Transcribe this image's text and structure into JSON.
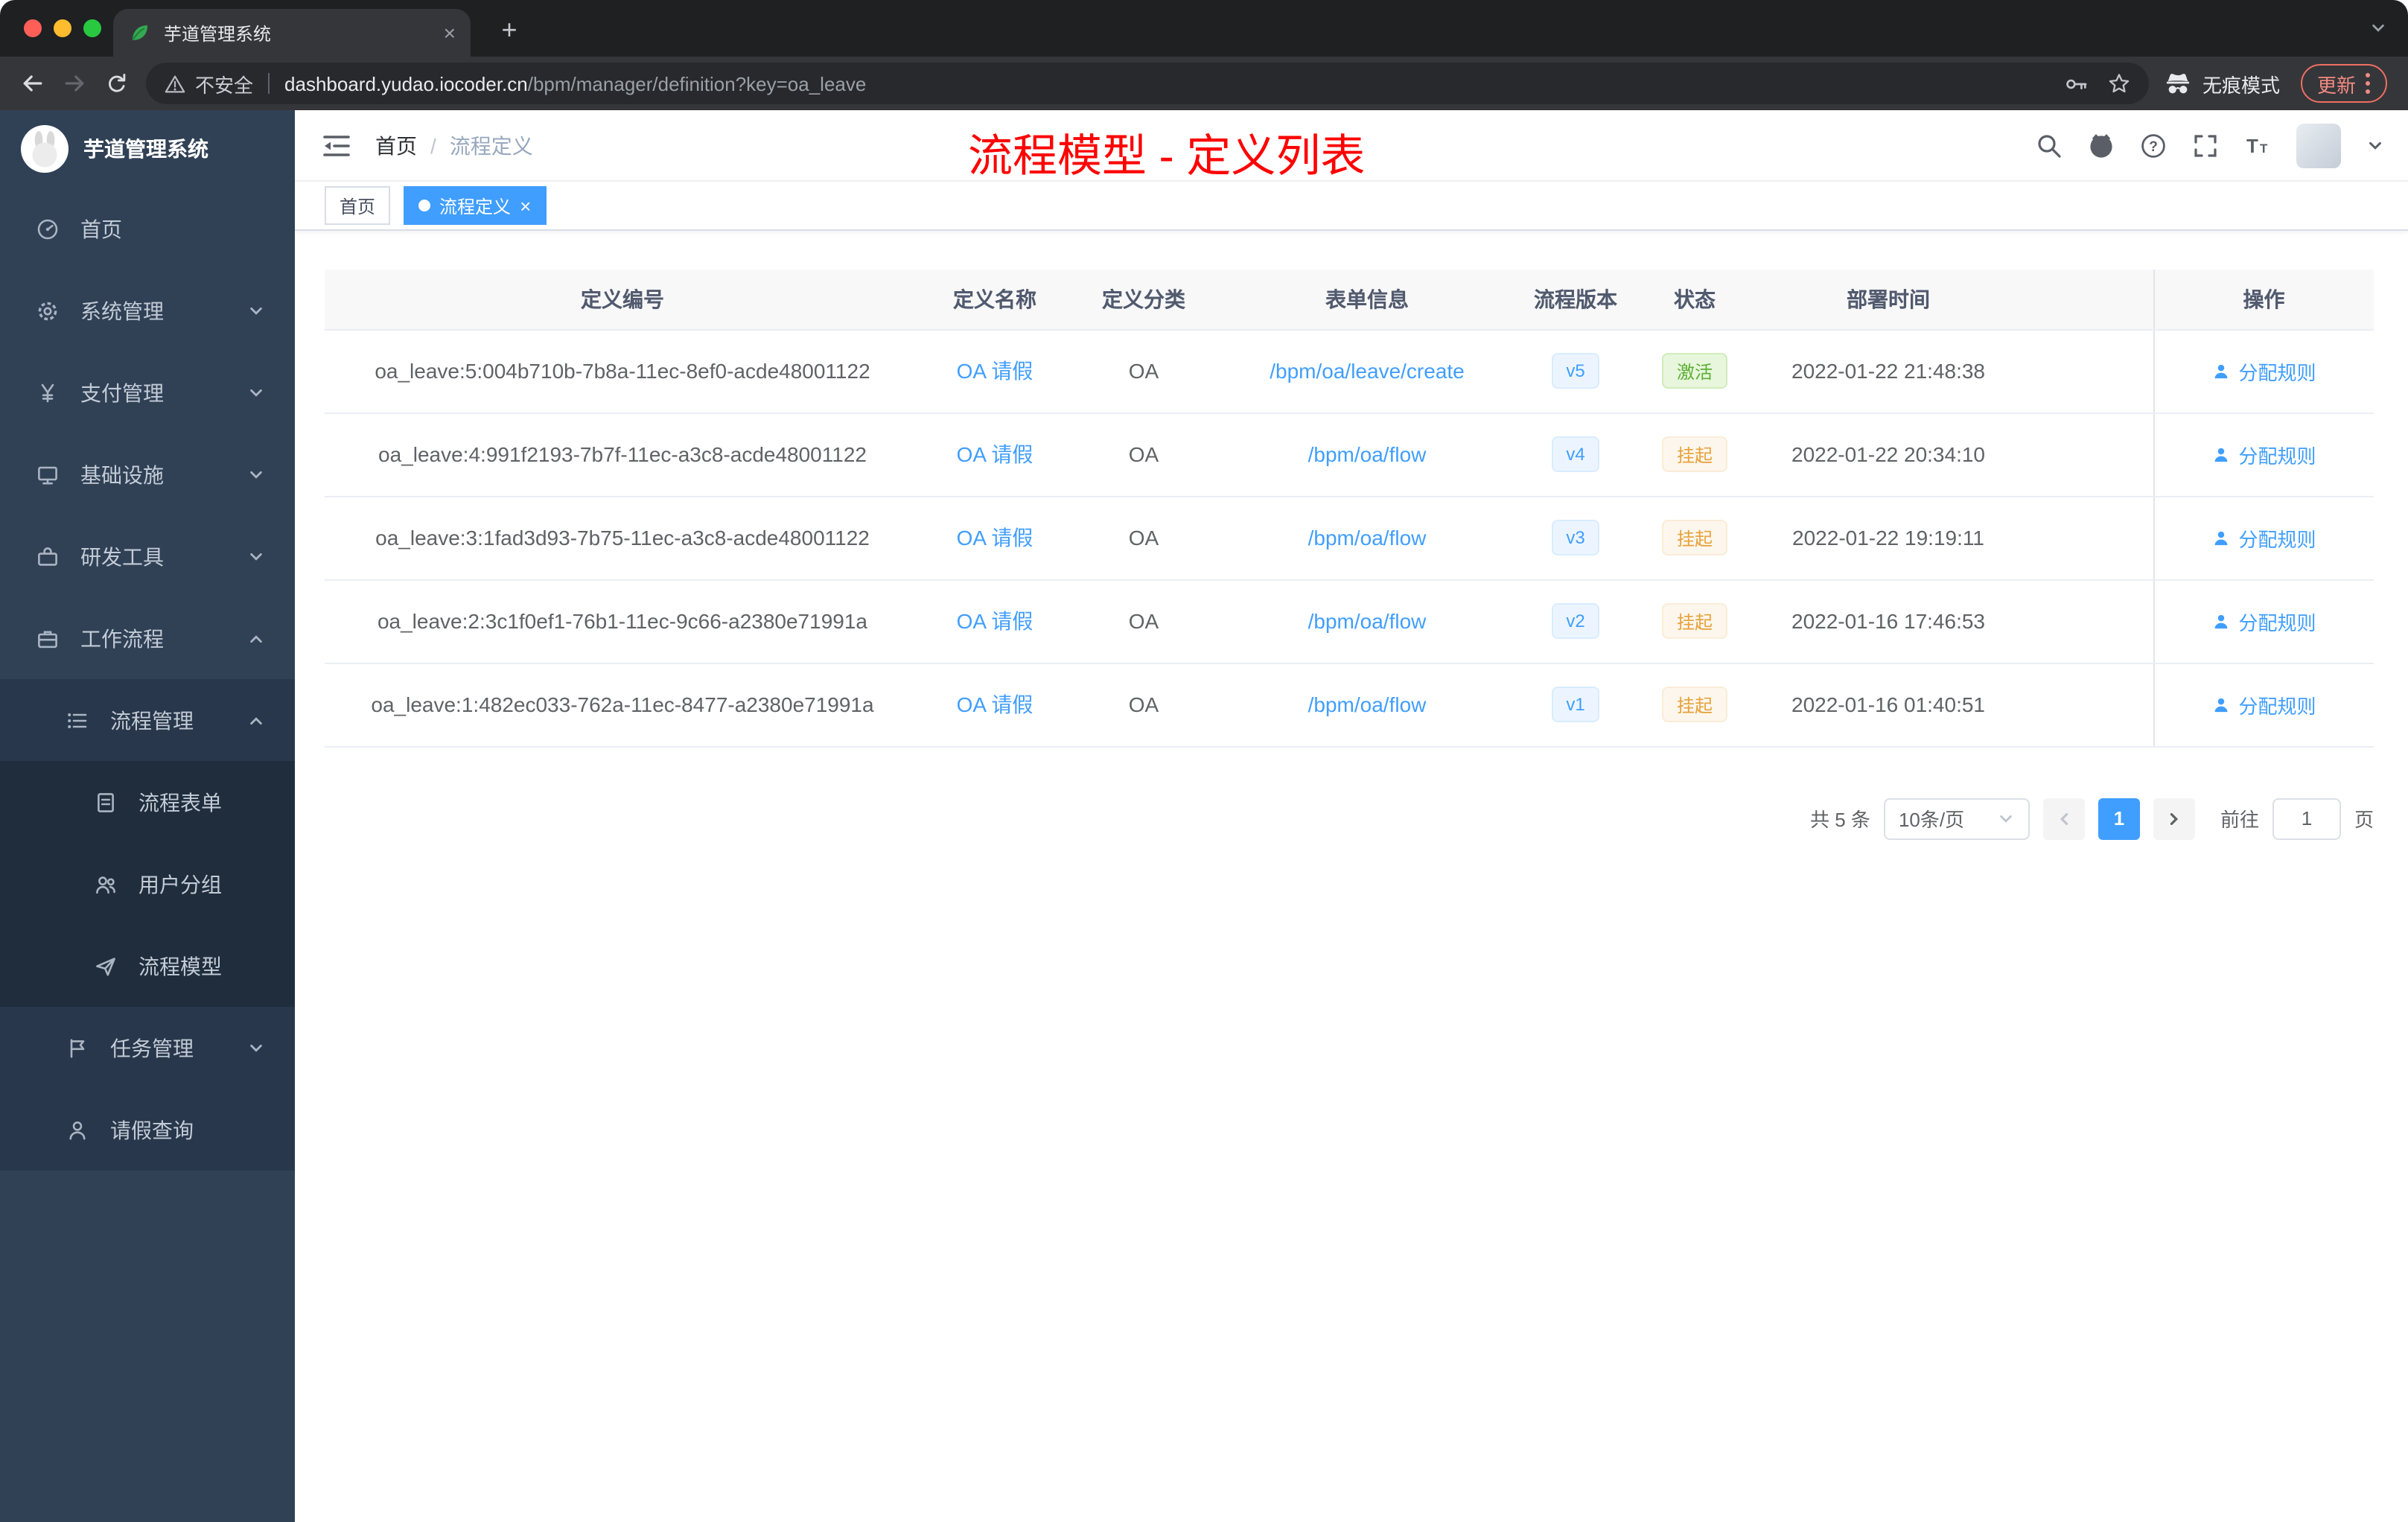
{
  "glyphs": {
    "close": "×",
    "plus": "+"
  },
  "browser": {
    "tab": {
      "title": "芋道管理系统"
    },
    "toolbar": {
      "security_label": "不安全",
      "url_host": "dashboard.yudao.iocoder.cn",
      "url_path": "/bpm/manager/definition?key=oa_leave",
      "incognito_label": "无痕模式",
      "update_label": "更新"
    }
  },
  "sidebar": {
    "logo_title": "芋道管理系统",
    "items": [
      {
        "key": "home",
        "label": "首页",
        "icon": "dashboard-icon",
        "level": 1,
        "chevron": "none"
      },
      {
        "key": "system-mgmt",
        "label": "系统管理",
        "icon": "gear-icon",
        "level": 1,
        "chevron": "down"
      },
      {
        "key": "payment-mgmt",
        "label": "支付管理",
        "icon": "yen-icon",
        "level": 1,
        "chevron": "down"
      },
      {
        "key": "infrastructure",
        "label": "基础设施",
        "icon": "monitor-icon",
        "level": 1,
        "chevron": "down"
      },
      {
        "key": "dev-tools",
        "label": "研发工具",
        "icon": "toolbox-icon",
        "level": 1,
        "chevron": "down"
      },
      {
        "key": "workflow",
        "label": "工作流程",
        "icon": "briefcase-icon",
        "level": 1,
        "chevron": "up"
      },
      {
        "key": "process-mgmt",
        "label": "流程管理",
        "icon": "list-icon",
        "level": 2,
        "chevron": "up"
      },
      {
        "key": "process-form",
        "label": "流程表单",
        "icon": "document-icon",
        "level": 3,
        "chevron": "none"
      },
      {
        "key": "user-group",
        "label": "用户分组",
        "icon": "user-group-icon",
        "level": 3,
        "chevron": "none"
      },
      {
        "key": "process-model",
        "label": "流程模型",
        "icon": "send-icon",
        "level": 3,
        "chevron": "none"
      },
      {
        "key": "task-mgmt",
        "label": "任务管理",
        "icon": "flag-icon",
        "level": 2,
        "chevron": "down"
      },
      {
        "key": "leave-query",
        "label": "请假查询",
        "icon": "person-icon",
        "level": 2,
        "chevron": "none"
      }
    ]
  },
  "header": {
    "breadcrumb": {
      "home": "首页",
      "separator": "/",
      "current": "流程定义"
    },
    "annotation": "流程模型 - 定义列表"
  },
  "tags": [
    {
      "key": "home",
      "label": "首页",
      "active": false
    },
    {
      "key": "process-definition",
      "label": "流程定义",
      "active": true
    }
  ],
  "table": {
    "columns": [
      "定义编号",
      "定义名称",
      "定义分类",
      "表单信息",
      "流程版本",
      "状态",
      "部署时间",
      "操作"
    ],
    "action_label": "分配规则",
    "rows": [
      {
        "id": "oa_leave:5:004b710b-7b8a-11ec-8ef0-acde48001122",
        "name": "OA 请假",
        "category": "OA",
        "form": "/bpm/oa/leave/create",
        "version": "v5",
        "status": "激活",
        "status_type": "success",
        "deploy_time": "2022-01-22 21:48:38"
      },
      {
        "id": "oa_leave:4:991f2193-7b7f-11ec-a3c8-acde48001122",
        "name": "OA 请假",
        "category": "OA",
        "form": "/bpm/oa/flow",
        "version": "v4",
        "status": "挂起",
        "status_type": "warning",
        "deploy_time": "2022-01-22 20:34:10"
      },
      {
        "id": "oa_leave:3:1fad3d93-7b75-11ec-a3c8-acde48001122",
        "name": "OA 请假",
        "category": "OA",
        "form": "/bpm/oa/flow",
        "version": "v3",
        "status": "挂起",
        "status_type": "warning",
        "deploy_time": "2022-01-22 19:19:11"
      },
      {
        "id": "oa_leave:2:3c1f0ef1-76b1-11ec-9c66-a2380e71991a",
        "name": "OA 请假",
        "category": "OA",
        "form": "/bpm/oa/flow",
        "version": "v2",
        "status": "挂起",
        "status_type": "warning",
        "deploy_time": "2022-01-16 17:46:53"
      },
      {
        "id": "oa_leave:1:482ec033-762a-11ec-8477-a2380e71991a",
        "name": "OA 请假",
        "category": "OA",
        "form": "/bpm/oa/flow",
        "version": "v1",
        "status": "挂起",
        "status_type": "warning",
        "deploy_time": "2022-01-16 01:40:51"
      }
    ]
  },
  "pagination": {
    "total": "共 5 条",
    "page_size": "10条/页",
    "page": "1",
    "goto_label": "前往",
    "goto_value": "1",
    "unit_label": "页"
  },
  "colors": {
    "accent": "#409eff",
    "success": "#67c23a",
    "warning": "#e6a23c",
    "annotation": "#ff0000",
    "sidebar": "#304156"
  }
}
